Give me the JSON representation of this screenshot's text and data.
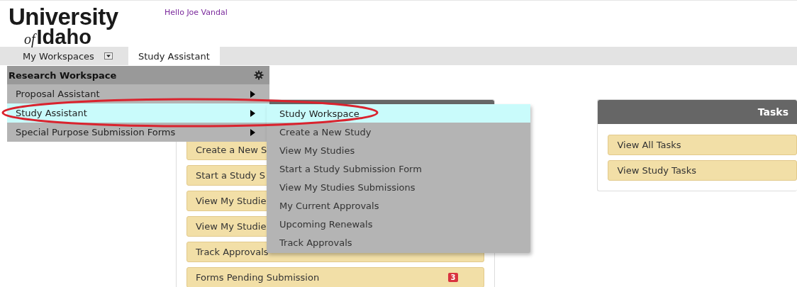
{
  "logo": {
    "line1": "University",
    "prefix": "of",
    "line2": "Idaho"
  },
  "greeting": "Hello Joe Vandal",
  "tabs": [
    {
      "label": "My Workspaces",
      "selected": false,
      "dropdown": true
    },
    {
      "label": "Study Assistant",
      "selected": true,
      "dropdown": false
    }
  ],
  "workspace_menu": {
    "title": "Research Workspace",
    "items": [
      {
        "label": "Proposal Assistant",
        "selected": false
      },
      {
        "label": "Study Assistant",
        "selected": true
      },
      {
        "label": "Special Purpose Submission Forms",
        "selected": false
      }
    ]
  },
  "submenu": {
    "items": [
      {
        "label": "Study Workspace",
        "selected": true
      },
      {
        "label": "Create a New Study",
        "selected": false
      },
      {
        "label": "View My Studies",
        "selected": false
      },
      {
        "label": "Start a Study Submission Form",
        "selected": false
      },
      {
        "label": "View My Studies Submissions",
        "selected": false
      },
      {
        "label": "My Current Approvals",
        "selected": false
      },
      {
        "label": "Upcoming Renewals",
        "selected": false
      },
      {
        "label": "Track Approvals",
        "selected": false
      }
    ]
  },
  "study_panel": {
    "buttons": [
      {
        "label": "Create a New S"
      },
      {
        "label": "Start a Study S"
      },
      {
        "label": "View My Studie"
      },
      {
        "label": "View My Studie"
      },
      {
        "label": "Track Approvals"
      },
      {
        "label": "Forms Pending Submission",
        "badge": "3"
      }
    ]
  },
  "tasks_panel": {
    "title": "Tasks",
    "buttons": [
      {
        "label": "View All Tasks"
      },
      {
        "label": "View Study Tasks"
      }
    ]
  }
}
